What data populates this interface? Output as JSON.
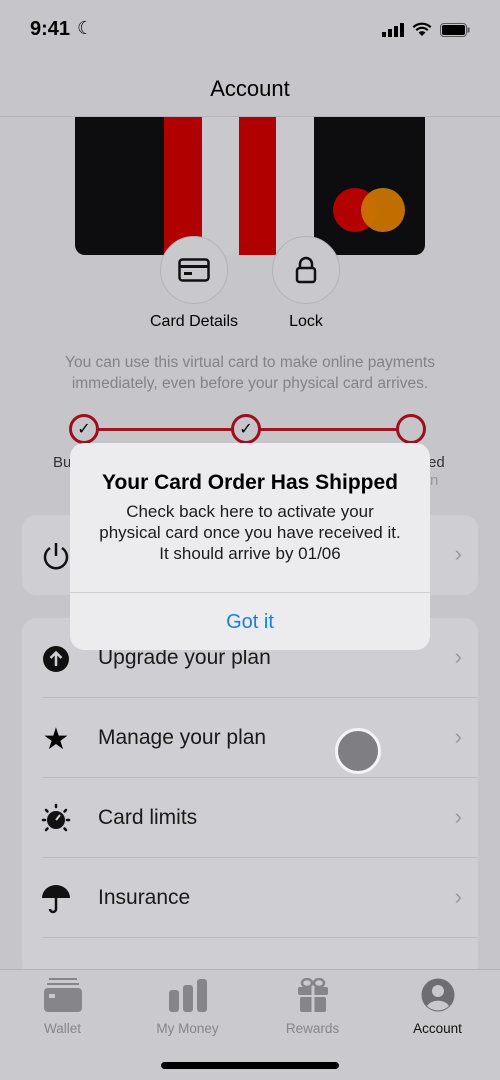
{
  "status_bar": {
    "time": "9:41"
  },
  "header": {
    "title": "Account"
  },
  "card_actions": [
    {
      "label": "Card Details",
      "icon": "card-icon"
    },
    {
      "label": "Lock",
      "icon": "lock-icon"
    }
  ],
  "info_text": "You can use this virtual card to make online payments immediately, even before your physical card arrives.",
  "progress": {
    "steps_completed": 2,
    "steps_total": 3,
    "label_left": "Bu",
    "label_right": "ed",
    "label_right_2": "n"
  },
  "menu": [
    {
      "label": "Upgrade your plan",
      "icon": "arrow-up-circle-icon"
    },
    {
      "label": "Manage your plan",
      "icon": "star-icon"
    },
    {
      "label": "Card limits",
      "icon": "gauge-icon"
    },
    {
      "label": "Insurance",
      "icon": "umbrella-icon"
    }
  ],
  "dialog": {
    "title": "Your Card Order Has Shipped",
    "message": "Check back here to activate your physical card once you have received it. It should arrive by 01/06",
    "button": "Got it"
  },
  "tabs": [
    {
      "label": "Wallet"
    },
    {
      "label": "My Money"
    },
    {
      "label": "Rewards"
    },
    {
      "label": "Account",
      "active": true
    }
  ],
  "colors": {
    "accent": "#1a7ee0",
    "brand_red": "#b30000"
  }
}
